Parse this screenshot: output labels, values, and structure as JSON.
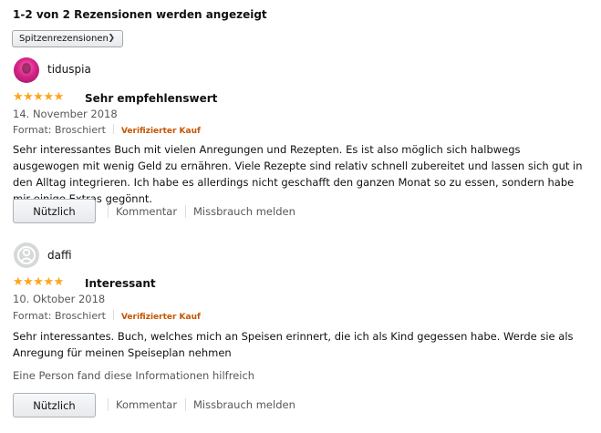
{
  "header": {
    "summary": "1-2 von 2 Rezensionen werden angezeigt",
    "sort_selected": "Spitzenrezensionen"
  },
  "reviews": [
    {
      "user": "tiduspia",
      "stars": 5,
      "star_glyphs": "★★★★★",
      "title": "Sehr empfehlenswert",
      "date": "14. November 2018",
      "format": "Format: Broschiert",
      "verified": "Verifizierter Kauf",
      "body": "Sehr interessantes Buch mit vielen Anregungen und Rezepten. Es ist also möglich sich halbwegs ausgewogen mit wenig Geld zu ernähren. Viele Rezepte sind relativ schnell zubereitet und lassen sich gut in den Alltag integrieren. Ich habe es allerdings nicht geschafft den ganzen Monat so zu essen, sondern habe mir einige Extras gegönnt.",
      "helpful_note": "",
      "helpful_button": "Nützlich",
      "comment_link": "Kommentar",
      "report_link": "Missbrauch melden"
    },
    {
      "user": "daffi",
      "stars": 5,
      "star_glyphs": "★★★★★",
      "title": "Interessant",
      "date": "10. Oktober 2018",
      "format": "Format: Broschiert",
      "verified": "Verifizierter Kauf",
      "body": "Sehr interessantes. Buch, welches mich an Speisen erinnert, die ich als Kind gegessen habe. Werde sie als Anregung für meinen Speiseplan nehmen",
      "helpful_note": "Eine Person fand diese Informationen hilfreich",
      "helpful_button": "Nützlich",
      "comment_link": "Kommentar",
      "report_link": "Missbrauch melden"
    }
  ],
  "colors": {
    "star": "#ffa41c",
    "verified": "#c45500",
    "secondary_text": "#565959"
  }
}
